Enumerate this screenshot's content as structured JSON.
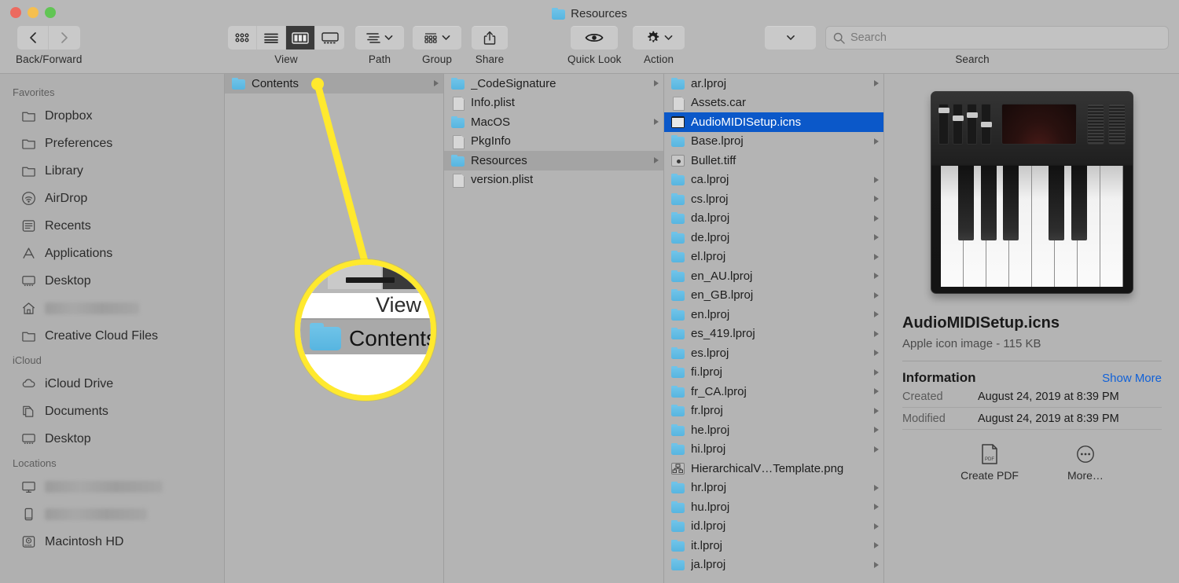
{
  "window": {
    "title": "Resources",
    "title_icon": "folder-icon"
  },
  "toolbar": {
    "back_forward_label": "Back/Forward",
    "back_icon": "chevron-left-icon",
    "forward_icon": "chevron-right-icon",
    "view_label": "View",
    "view_modes": [
      "icon-view-icon",
      "list-view-icon",
      "column-view-icon",
      "gallery-view-icon"
    ],
    "view_active_index": 2,
    "path_label": "Path",
    "path_icon": "path-list-icon",
    "group_label": "Group",
    "group_icon": "group-grid-icon",
    "share_label": "Share",
    "share_icon": "share-arrow-icon",
    "quick_look_label": "Quick Look",
    "quick_look_icon": "eye-icon",
    "action_label": "Action",
    "action_icon": "gear-icon",
    "arrange_icon": "chevron-down-icon",
    "search_label": "Search",
    "search_placeholder": "Search",
    "search_value": "",
    "search_icon": "magnifier-icon"
  },
  "sidebar": {
    "sections": [
      {
        "header": "Favorites",
        "items": [
          {
            "label": "Dropbox",
            "icon": "folder-icon",
            "blurred": false
          },
          {
            "label": "Preferences",
            "icon": "folder-icon",
            "blurred": false
          },
          {
            "label": "Library",
            "icon": "folder-icon",
            "blurred": false
          },
          {
            "label": "AirDrop",
            "icon": "airdrop-icon",
            "blurred": false
          },
          {
            "label": "Recents",
            "icon": "recents-clock-icon",
            "blurred": false
          },
          {
            "label": "Applications",
            "icon": "applications-icon",
            "blurred": false
          },
          {
            "label": "Desktop",
            "icon": "desktop-icon",
            "blurred": false
          },
          {
            "label": "",
            "icon": "home-icon",
            "blurred": true
          },
          {
            "label": "Creative Cloud Files",
            "icon": "folder-icon",
            "blurred": false
          }
        ]
      },
      {
        "header": "iCloud",
        "items": [
          {
            "label": "iCloud Drive",
            "icon": "cloud-icon",
            "blurred": false
          },
          {
            "label": "Documents",
            "icon": "documents-icon",
            "blurred": false
          },
          {
            "label": "Desktop",
            "icon": "desktop-icon",
            "blurred": false
          }
        ]
      },
      {
        "header": "Locations",
        "items": [
          {
            "label": "",
            "icon": "imac-icon",
            "blurred": true
          },
          {
            "label": "",
            "icon": "iphone-icon",
            "blurred": true
          },
          {
            "label": "Macintosh HD",
            "icon": "harddisk-icon",
            "blurred": false
          }
        ]
      }
    ]
  },
  "columns": [
    {
      "name": "column-contents",
      "rows": [
        {
          "label": "Contents",
          "icon": "folder-icon",
          "has_disclosure": true,
          "state": "selected-inactive"
        }
      ]
    },
    {
      "name": "column-bundle",
      "rows": [
        {
          "label": "_CodeSignature",
          "icon": "folder-icon",
          "has_disclosure": true,
          "state": "normal"
        },
        {
          "label": "Info.plist",
          "icon": "document-icon",
          "has_disclosure": false,
          "state": "normal"
        },
        {
          "label": "MacOS",
          "icon": "folder-icon",
          "has_disclosure": true,
          "state": "normal"
        },
        {
          "label": "PkgInfo",
          "icon": "document-icon",
          "has_disclosure": false,
          "state": "normal"
        },
        {
          "label": "Resources",
          "icon": "folder-icon",
          "has_disclosure": true,
          "state": "selected-inactive"
        },
        {
          "label": "version.plist",
          "icon": "document-icon",
          "has_disclosure": false,
          "state": "normal"
        }
      ]
    },
    {
      "name": "column-resources",
      "rows": [
        {
          "label": "ar.lproj",
          "icon": "folder-icon",
          "has_disclosure": true,
          "state": "normal"
        },
        {
          "label": "Assets.car",
          "icon": "document-icon",
          "has_disclosure": false,
          "state": "normal"
        },
        {
          "label": "AudioMIDISetup.icns",
          "icon": "midi-keyboard-icon",
          "has_disclosure": false,
          "state": "selected-active"
        },
        {
          "label": "Base.lproj",
          "icon": "folder-icon",
          "has_disclosure": true,
          "state": "normal"
        },
        {
          "label": "Bullet.tiff",
          "icon": "tiff-image-icon",
          "has_disclosure": false,
          "state": "normal"
        },
        {
          "label": "ca.lproj",
          "icon": "folder-icon",
          "has_disclosure": true,
          "state": "normal"
        },
        {
          "label": "cs.lproj",
          "icon": "folder-icon",
          "has_disclosure": true,
          "state": "normal"
        },
        {
          "label": "da.lproj",
          "icon": "folder-icon",
          "has_disclosure": true,
          "state": "normal"
        },
        {
          "label": "de.lproj",
          "icon": "folder-icon",
          "has_disclosure": true,
          "state": "normal"
        },
        {
          "label": "el.lproj",
          "icon": "folder-icon",
          "has_disclosure": true,
          "state": "normal"
        },
        {
          "label": "en_AU.lproj",
          "icon": "folder-icon",
          "has_disclosure": true,
          "state": "normal"
        },
        {
          "label": "en_GB.lproj",
          "icon": "folder-icon",
          "has_disclosure": true,
          "state": "normal"
        },
        {
          "label": "en.lproj",
          "icon": "folder-icon",
          "has_disclosure": true,
          "state": "normal"
        },
        {
          "label": "es_419.lproj",
          "icon": "folder-icon",
          "has_disclosure": true,
          "state": "normal"
        },
        {
          "label": "es.lproj",
          "icon": "folder-icon",
          "has_disclosure": true,
          "state": "normal"
        },
        {
          "label": "fi.lproj",
          "icon": "folder-icon",
          "has_disclosure": true,
          "state": "normal"
        },
        {
          "label": "fr_CA.lproj",
          "icon": "folder-icon",
          "has_disclosure": true,
          "state": "normal"
        },
        {
          "label": "fr.lproj",
          "icon": "folder-icon",
          "has_disclosure": true,
          "state": "normal"
        },
        {
          "label": "he.lproj",
          "icon": "folder-icon",
          "has_disclosure": true,
          "state": "normal"
        },
        {
          "label": "hi.lproj",
          "icon": "folder-icon",
          "has_disclosure": true,
          "state": "normal"
        },
        {
          "label": "HierarchicalV…Template.png",
          "icon": "png-image-icon",
          "has_disclosure": false,
          "state": "normal"
        },
        {
          "label": "hr.lproj",
          "icon": "folder-icon",
          "has_disclosure": true,
          "state": "normal"
        },
        {
          "label": "hu.lproj",
          "icon": "folder-icon",
          "has_disclosure": true,
          "state": "normal"
        },
        {
          "label": "id.lproj",
          "icon": "folder-icon",
          "has_disclosure": true,
          "state": "normal"
        },
        {
          "label": "it.lproj",
          "icon": "folder-icon",
          "has_disclosure": true,
          "state": "normal"
        },
        {
          "label": "ja.lproj",
          "icon": "folder-icon",
          "has_disclosure": true,
          "state": "normal"
        }
      ]
    }
  ],
  "preview": {
    "image_icon": "midi-keyboard-preview-icon",
    "file_name": "AudioMIDISetup.icns",
    "file_kind": "Apple icon image - 115 KB",
    "information_title": "Information",
    "show_more": "Show More",
    "info_rows": [
      {
        "key": "Created",
        "value": "August 24, 2019 at 8:39 PM"
      },
      {
        "key": "Modified",
        "value": "August 24, 2019 at 8:39 PM"
      }
    ],
    "actions": [
      {
        "label": "Create PDF",
        "icon": "pdf-document-icon"
      },
      {
        "label": "More…",
        "icon": "ellipsis-circle-icon"
      }
    ]
  },
  "callout": {
    "color": "#ffe92e",
    "magnified_view_label": "View",
    "magnified_row_label": "Contents"
  }
}
